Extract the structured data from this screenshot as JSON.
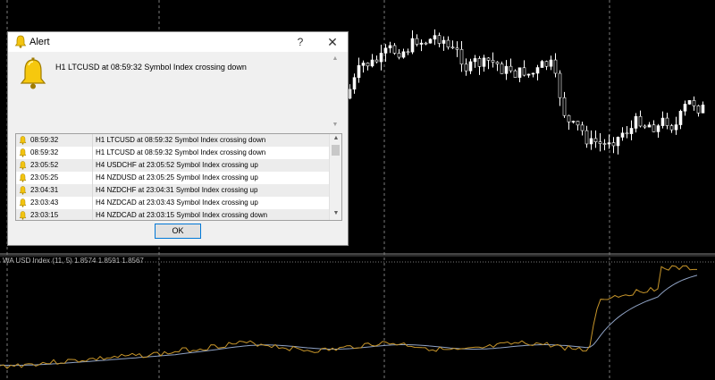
{
  "indicator": {
    "label": "WA USD Index (11, 5) 1.8574 1.8591 1.8567"
  },
  "dialog": {
    "title": "Alert",
    "help_label": "?",
    "close_label": "✕",
    "message": "H1 LTCUSD at 08:59:32 Symbol Index  crossing down",
    "ok_label": "OK",
    "icon": "bell-icon"
  },
  "alerts": [
    {
      "time": "08:59:32",
      "message": "H1 LTCUSD at 08:59:32 Symbol Index  crossing down"
    },
    {
      "time": "08:59:32",
      "message": "H1 LTCUSD at 08:59:32 Symbol Index  crossing down"
    },
    {
      "time": "23:05:52",
      "message": "H4 USDCHF at 23:05:52 Symbol Index  crossing up"
    },
    {
      "time": "23:05:25",
      "message": "H4 NZDUSD at 23:05:25 Symbol Index  crossing up"
    },
    {
      "time": "23:04:31",
      "message": "H4 NZDCHF at 23:04:31 Symbol Index  crossing up"
    },
    {
      "time": "23:03:43",
      "message": "H4 NZDCAD at 23:03:43 Symbol Index  crossing up"
    },
    {
      "time": "23:03:15",
      "message": "H4 NZDCAD at 23:03:15 Symbol Index  crossing down"
    }
  ],
  "colors": {
    "background": "#000000",
    "candle_bull": "#ffffff",
    "candle_bear": "#000000",
    "fast_line": "#c8962a",
    "slow_line": "#8fa2c4",
    "accent": "#0078d7"
  }
}
